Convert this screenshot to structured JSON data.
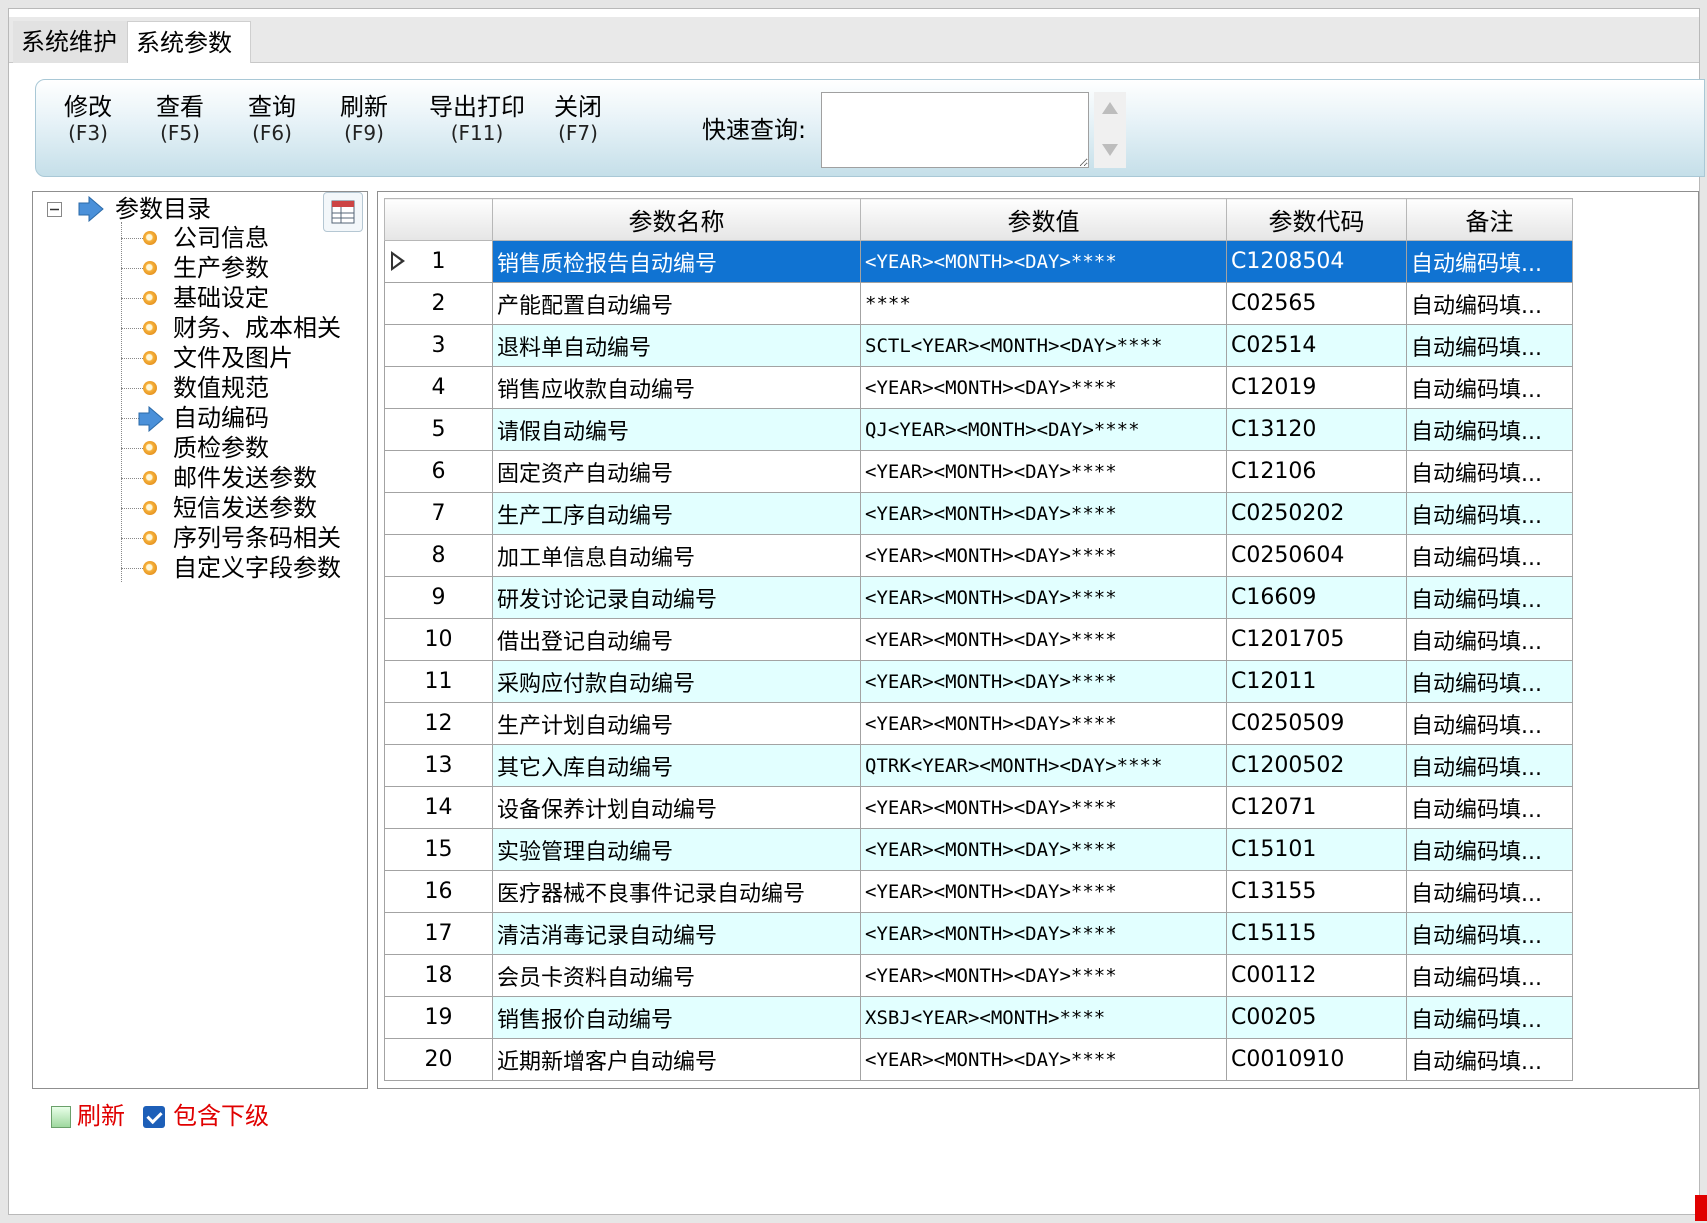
{
  "tabs": [
    {
      "label": "系统维护"
    },
    {
      "label": "系统参数"
    }
  ],
  "toolbar": {
    "buttons": [
      {
        "label": "修改",
        "key": "(F3)"
      },
      {
        "label": "查看",
        "key": "(F5)"
      },
      {
        "label": "查询",
        "key": "(F6)"
      },
      {
        "label": "刷新",
        "key": "(F9)"
      },
      {
        "label": "导出打印",
        "key": "(F11)"
      },
      {
        "label": "关闭",
        "key": "(F7)"
      }
    ],
    "search_label": "快速查询:",
    "search_value": ""
  },
  "tree": {
    "root": "参数目录",
    "items": [
      {
        "label": "公司信息"
      },
      {
        "label": "生产参数"
      },
      {
        "label": "基础设定"
      },
      {
        "label": "财务、成本相关"
      },
      {
        "label": "文件及图片"
      },
      {
        "label": "数值规范"
      },
      {
        "label": "自动编码",
        "selected": true
      },
      {
        "label": "质检参数"
      },
      {
        "label": "邮件发送参数"
      },
      {
        "label": "短信发送参数"
      },
      {
        "label": "序列号条码相关"
      },
      {
        "label": "自定义字段参数"
      }
    ]
  },
  "grid": {
    "columns": [
      "参数名称",
      "参数值",
      "参数代码",
      "备注"
    ],
    "rows": [
      {
        "n": "1",
        "name": "销售质检报告自动编号",
        "value": "<YEAR><MONTH><DAY>****",
        "code": "C1208504",
        "note": "自动编码填..."
      },
      {
        "n": "2",
        "name": "产能配置自动编号",
        "value": "****",
        "code": "C02565",
        "note": "自动编码填..."
      },
      {
        "n": "3",
        "name": "退料单自动编号",
        "value": "SCTL<YEAR><MONTH><DAY>****",
        "code": "C02514",
        "note": "自动编码填..."
      },
      {
        "n": "4",
        "name": "销售应收款自动编号",
        "value": "<YEAR><MONTH><DAY>****",
        "code": "C12019",
        "note": "自动编码填..."
      },
      {
        "n": "5",
        "name": "请假自动编号",
        "value": "QJ<YEAR><MONTH><DAY>****",
        "code": "C13120",
        "note": "自动编码填..."
      },
      {
        "n": "6",
        "name": "固定资产自动编号",
        "value": "<YEAR><MONTH><DAY>****",
        "code": "C12106",
        "note": "自动编码填..."
      },
      {
        "n": "7",
        "name": "生产工序自动编号",
        "value": "<YEAR><MONTH><DAY>****",
        "code": "C0250202",
        "note": "自动编码填..."
      },
      {
        "n": "8",
        "name": "加工单信息自动编号",
        "value": "<YEAR><MONTH><DAY>****",
        "code": "C0250604",
        "note": "自动编码填..."
      },
      {
        "n": "9",
        "name": "研发讨论记录自动编号",
        "value": "<YEAR><MONTH><DAY>****",
        "code": "C16609",
        "note": "自动编码填..."
      },
      {
        "n": "10",
        "name": "借出登记自动编号",
        "value": "<YEAR><MONTH><DAY>****",
        "code": "C1201705",
        "note": "自动编码填..."
      },
      {
        "n": "11",
        "name": "采购应付款自动编号",
        "value": "<YEAR><MONTH><DAY>****",
        "code": "C12011",
        "note": "自动编码填..."
      },
      {
        "n": "12",
        "name": "生产计划自动编号",
        "value": "<YEAR><MONTH><DAY>****",
        "code": "C0250509",
        "note": "自动编码填..."
      },
      {
        "n": "13",
        "name": "其它入库自动编号",
        "value": "QTRK<YEAR><MONTH><DAY>****",
        "code": "C1200502",
        "note": "自动编码填..."
      },
      {
        "n": "14",
        "name": "设备保养计划自动编号",
        "value": "<YEAR><MONTH><DAY>****",
        "code": "C12071",
        "note": "自动编码填..."
      },
      {
        "n": "15",
        "name": "实验管理自动编号",
        "value": "<YEAR><MONTH><DAY>****",
        "code": "C15101",
        "note": "自动编码填..."
      },
      {
        "n": "16",
        "name": "医疗器械不良事件记录自动编号",
        "value": "<YEAR><MONTH><DAY>****",
        "code": "C13155",
        "note": "自动编码填..."
      },
      {
        "n": "17",
        "name": "清洁消毒记录自动编号",
        "value": "<YEAR><MONTH><DAY>****",
        "code": "C15115",
        "note": "自动编码填..."
      },
      {
        "n": "18",
        "name": "会员卡资料自动编号",
        "value": "<YEAR><MONTH><DAY>****",
        "code": "C00112",
        "note": "自动编码填..."
      },
      {
        "n": "19",
        "name": "销售报价自动编号",
        "value": "XSBJ<YEAR><MONTH>****",
        "code": "C00205",
        "note": "自动编码填..."
      },
      {
        "n": "20",
        "name": "近期新增客户自动编号",
        "value": "<YEAR><MONTH><DAY>****",
        "code": "C0010910",
        "note": "自动编码填..."
      }
    ],
    "selected_index": 0
  },
  "footer": {
    "refresh_label": "刷新",
    "include_sub_label": "包含下级",
    "include_sub_checked": true
  },
  "colors": {
    "selection": "#1073d2",
    "alt_row": "#e2ffff",
    "footer_text": "#e00000"
  }
}
